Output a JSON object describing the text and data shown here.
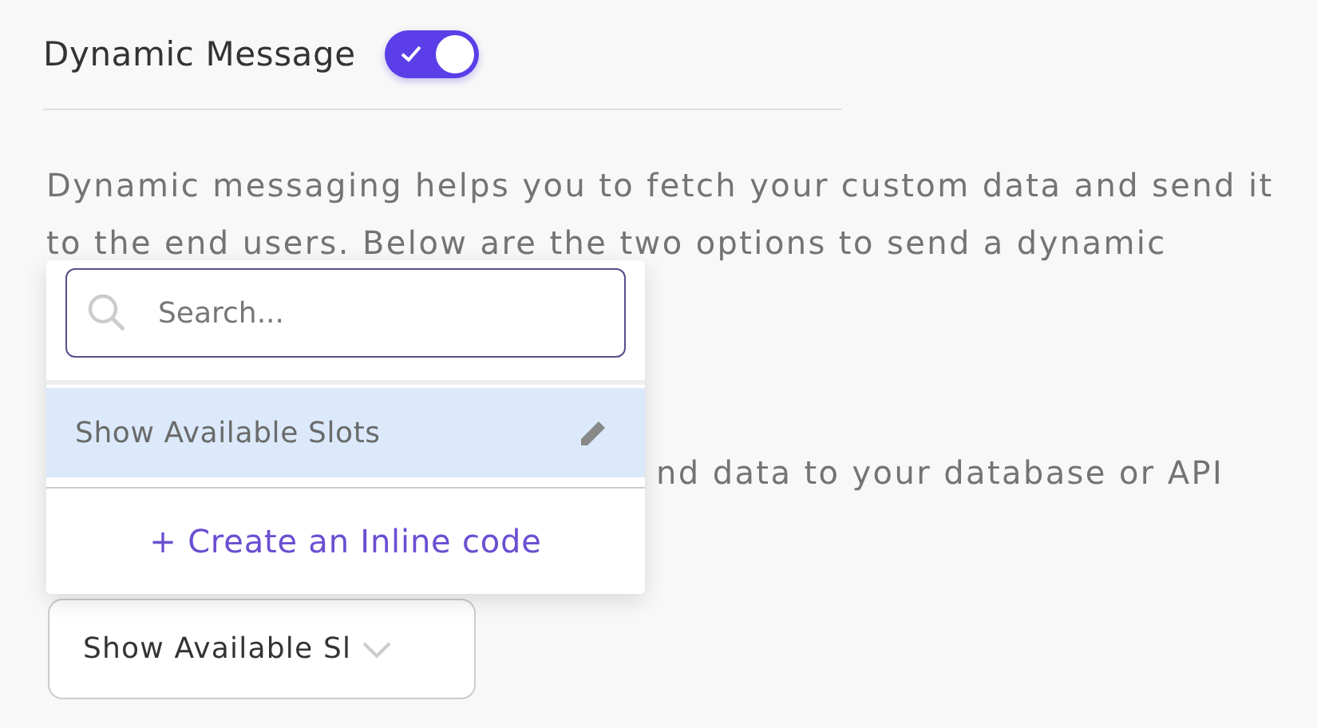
{
  "header": {
    "title": "Dynamic Message",
    "toggle": {
      "on": true
    }
  },
  "description_lines": [
    "Dynamic messaging helps you to fetch your custom data and send it",
    "to the end users. Below are the two options to send a dynamic"
  ],
  "partial_line": "nd data to your database or API",
  "select": {
    "value": "Show Available Sl"
  },
  "dropdown": {
    "search": {
      "placeholder": "Search..."
    },
    "options": [
      {
        "label": "Show Available Slots",
        "selected": true
      }
    ],
    "create_action": "+ Create an Inline code"
  }
}
